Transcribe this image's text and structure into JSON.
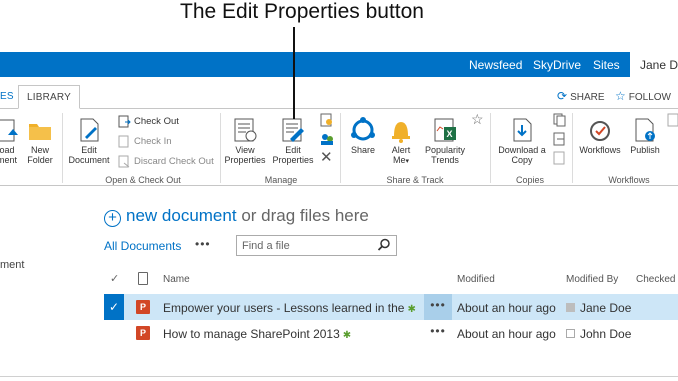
{
  "annotation": {
    "text": "The Edit Properties button"
  },
  "suitebar": {
    "links": [
      "Newsfeed",
      "SkyDrive",
      "Sites"
    ],
    "user": "Jane Do"
  },
  "tabs": [
    "ES",
    "LIBRARY"
  ],
  "tab_actions": {
    "share": "SHARE",
    "follow": "FOLLOW"
  },
  "ribbon": {
    "upload": {
      "l1": "oad",
      "l2": "ment"
    },
    "new_folder": {
      "l1": "New",
      "l2": "Folder"
    },
    "edit_document": {
      "l1": "Edit",
      "l2": "Document"
    },
    "check_out": "Check Out",
    "check_in": "Check In",
    "discard_check_out": "Discard Check Out",
    "view_properties": {
      "l1": "View",
      "l2": "Properties"
    },
    "edit_properties": {
      "l1": "Edit",
      "l2": "Properties"
    },
    "share": "Share",
    "alert_me": {
      "l1": "Alert",
      "l2": "Me"
    },
    "popularity_trends": {
      "l1": "Popularity",
      "l2": "Trends"
    },
    "download_copy": {
      "l1": "Download a",
      "l2": "Copy"
    },
    "workflows": "Workflows",
    "publish": "Publish",
    "groups": {
      "open_checkout": "Open & Check Out",
      "manage": "Manage",
      "share_track": "Share & Track",
      "copies": "Copies",
      "workflows": "Workflows"
    }
  },
  "main": {
    "new_document": "new document",
    "drag_text": "or drag files here",
    "all_documents": "All Documents",
    "more": "•••",
    "find_placeholder": "Find a file",
    "left_fragment": "ment",
    "columns": {
      "name": "Name",
      "modified": "Modified",
      "modified_by": "Modified By",
      "checked_out": "Checked O"
    },
    "rows": [
      {
        "name": "Empower your users - Lessons learned in the",
        "modified": "About an hour ago",
        "modified_by": "Jane Doe",
        "selected": true
      },
      {
        "name": "How to manage SharePoint 2013",
        "modified": "About an hour ago",
        "modified_by": "John Doe",
        "selected": false
      }
    ]
  },
  "colors": {
    "accent": "#0072c6",
    "selected_row": "#cde6f7",
    "ppt": "#d24726"
  }
}
